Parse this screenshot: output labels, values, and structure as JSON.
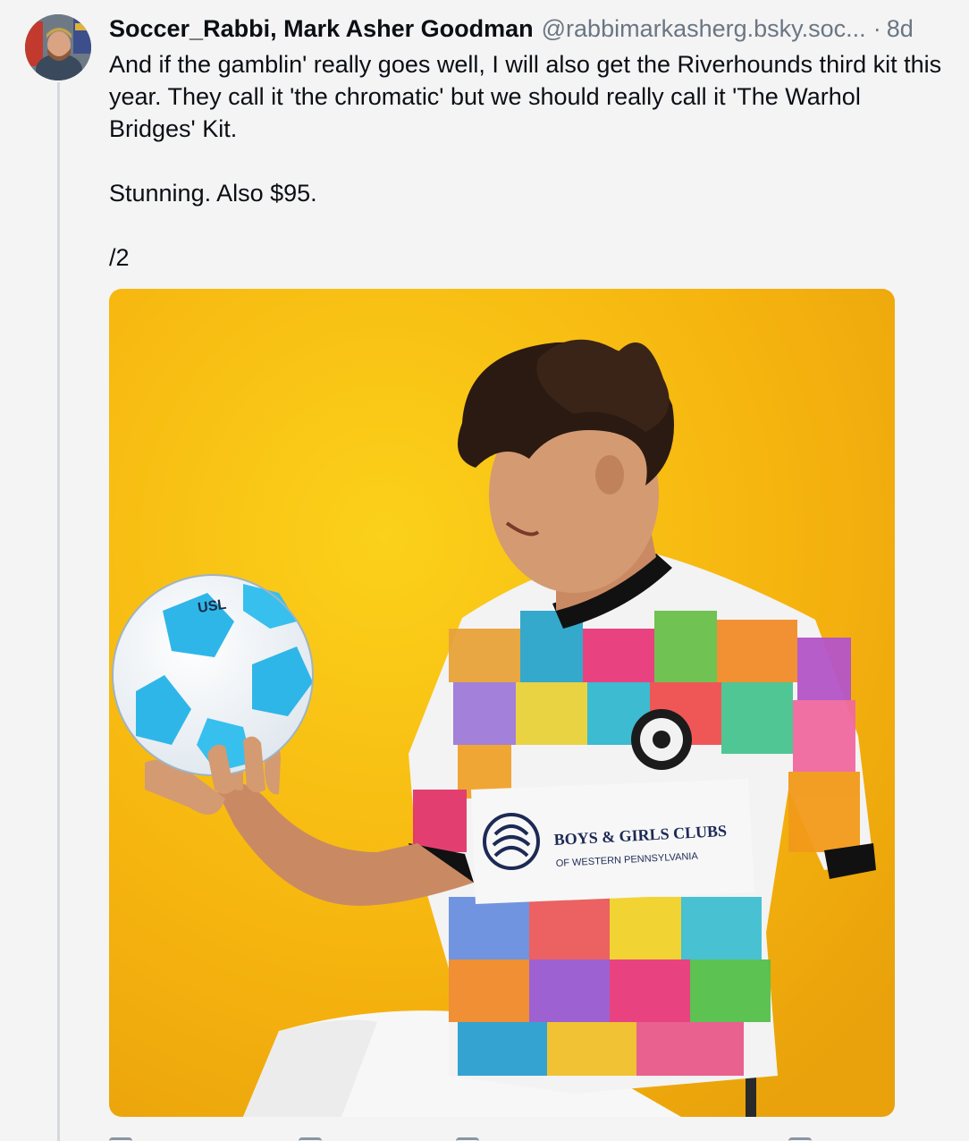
{
  "post": {
    "display_name": "Soccer_Rabbi, Mark Asher Goodman",
    "handle": "@rabbimarkasherg.bsky.soc...",
    "separator": "·",
    "time_ago": "8d",
    "paragraphs": [
      "And if the gamblin' really goes well, I will also get the Riverhounds third kit this year. They call it 'the chromatic' but we should really call it 'The Warhol Bridges' Kit.",
      "Stunning. Also $95.",
      "/2"
    ]
  },
  "avatar": {
    "icon": "user-avatar"
  },
  "media": {
    "kind": "photo",
    "subject": "player holding soccer ball in multicolor bridge-pattern jersey",
    "background_color": "#f6b90f",
    "ball_text": "USL",
    "sponsor_line1": "BOYS & GIRLS CLUBS",
    "sponsor_line2": "OF WESTERN PENNSYLVANIA"
  },
  "actions": [
    {
      "icon": "reply-icon"
    },
    {
      "icon": "repost-icon"
    },
    {
      "icon": "like-icon"
    },
    {
      "icon": "more-icon"
    }
  ]
}
